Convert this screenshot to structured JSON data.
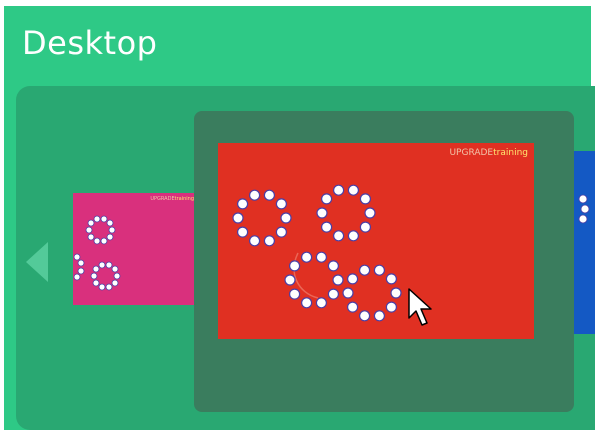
{
  "window": {
    "title": "Desktop"
  },
  "workspaces": [
    {
      "color": "#d9307d",
      "brand": {
        "part1": "UPGRADE",
        "part2": "training"
      }
    },
    {
      "color": "#e03022",
      "brand": {
        "part1": "UPGRADE",
        "part2": "training"
      },
      "selected": true
    },
    {
      "color": "#1459c4"
    }
  ],
  "colors": {
    "background": "#2ec986",
    "panel": "#29a872",
    "selection": "#3a7d5e"
  },
  "icons": {
    "previous": "chevron-left-icon",
    "pointer": "mouse-pointer-icon"
  }
}
